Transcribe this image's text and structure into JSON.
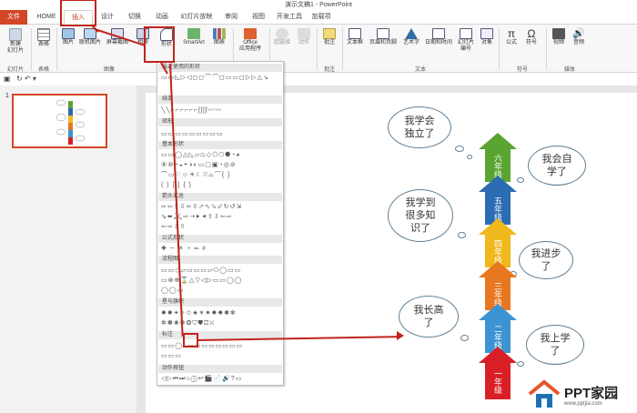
{
  "title": "演示文稿1 - PowerPoint",
  "tabs": [
    {
      "label": "文件"
    },
    {
      "label": "HOME"
    },
    {
      "label": "插入"
    },
    {
      "label": "设计"
    },
    {
      "label": "切换"
    },
    {
      "label": "动画"
    },
    {
      "label": "幻灯片放映"
    },
    {
      "label": "审阅"
    },
    {
      "label": "视图"
    },
    {
      "label": "开发工具"
    },
    {
      "label": "加载项"
    }
  ],
  "ribbon": {
    "new_slide": "新建\n幻灯片",
    "table": "表格",
    "picture": "图片",
    "online_picture": "联机图片",
    "screenshot": "屏幕截图",
    "album": "相册",
    "shapes": "形状",
    "smartart": "SmartArt",
    "chart": "图表",
    "office_apps": "Office\n应用程序",
    "hyperlink": "超链接",
    "action": "动作",
    "comment": "批注",
    "textbox": "文本框",
    "header_footer": "页眉和页脚",
    "wordart": "艺术字",
    "datetime": "日期和时间",
    "slide_number": "幻灯片\n编号",
    "object": "对象",
    "equation": "公式",
    "symbol": "符号",
    "video": "视频",
    "audio": "音频",
    "groups": {
      "slides": "幻灯片",
      "tables": "表格",
      "images": "图像",
      "comments": "批注",
      "text": "文本",
      "symbols": "符号",
      "media": "媒体"
    }
  },
  "gallery": {
    "sections": [
      "最近使用的形状",
      "线条",
      "矩形",
      "基本形状",
      "箭头汇总",
      "公式形状",
      "流程图",
      "星与旗帜",
      "标注",
      "动作按钮"
    ],
    "recent": "▭▭◺▷◁◻◻⌒⌒◻▭▭◻▷▷△↘",
    "lines": "╲╲⌐⌐⌐⌐⌐⌐ʃʃʃʃ〰〰",
    "rects": "▭▭▭▭▭▭▭▭▭",
    "basic1": "▭▭◯△◺▱⏢◇⬠⬡⯃◔◕",
    "basic2": "⑧⑩◔◒◓◑◐▭▢▣◔◎⊘",
    "basic3": "⌒▭♡☺☀☾⛆⌓⌒{ }",
    "basic4": "( ) [ ] { }",
    "arrow1": "⇨⇦⇧⇩⬄⇳⬀⬁⬂⬃↻↺⇲",
    "arrow2": "⇘⬌⤸⤹⇨⇢⯈⯇⇧⇩⇦⇨",
    "arrow3": "⇦⇨⇩⇧",
    "eq": "✚ ─ ✕ ÷ ═ ≠",
    "flow1": "▭▭◇▱▭▭▭▱⬭◯▭▭",
    "flow2": "▭⊗⊕⌛△▽◁▷▭▭◯◯",
    "flow3": "◯◯▭",
    "star1": "✹✹✦✧✩★✶✷✸✹✺✻",
    "star2": "✼✽❀❁❂⛉⛊⛋⛌",
    "callout1": "▭▭◯◌▭▭▭▭▭▭▭▭",
    "callout2": "▭▭▭",
    "action": "◁▷⏮⏭⌂ⓘ↩🎬📄🔊?▭"
  },
  "qat": "↻ ↶ ▾",
  "slide_num": "1",
  "clouds": [
    "我学会\n独立了",
    "我会自\n学了",
    "我学到\n很多知\n识了",
    "我进步\n了",
    "我长高\n了",
    "我上学\n了"
  ],
  "grades": [
    "六年级",
    "五年级",
    "四年级",
    "三年级",
    "二年级",
    "一年级"
  ],
  "colors": {
    "grades": [
      "#5aa432",
      "#2b6cb3",
      "#f0b81c",
      "#e87722",
      "#3d93d1",
      "#d91f26"
    ],
    "accent": "#d24726",
    "arrow": "#c0241b"
  },
  "logo": {
    "brand": "PPT家园",
    "url": "www.pptjia.com"
  }
}
